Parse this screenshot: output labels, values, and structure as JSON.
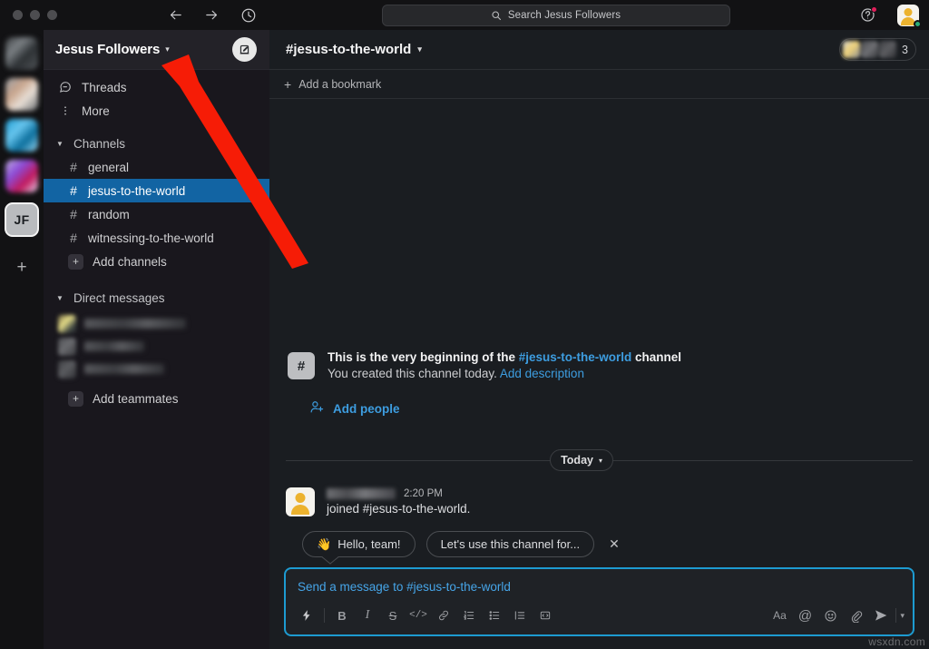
{
  "browser": {
    "back_icon": "arrow-left-icon",
    "forward_icon": "arrow-right-icon",
    "history_icon": "clock-icon",
    "search_placeholder": "Search Jesus Followers",
    "help_icon": "question-mark-icon",
    "user_avatar": "user-avatar"
  },
  "rail": {
    "workspaces": [
      {
        "name": "workspace-1",
        "colors": [
          "#3d4043",
          "#7b8084",
          "#2d3134",
          "#515559"
        ]
      },
      {
        "name": "workspace-2",
        "colors": [
          "#9aa0a6",
          "#c8a48c",
          "#e8dfd6",
          "#6b6f73"
        ]
      },
      {
        "name": "workspace-3",
        "colors": [
          "#1d9bd1",
          "#68c6ef",
          "#0b6e9c",
          "#9fdcf7"
        ]
      },
      {
        "name": "workspace-4",
        "colors": [
          "#c3b0e0",
          "#8b4dd8",
          "#c2185b",
          "#e6dcf5"
        ]
      }
    ],
    "active_workspace_initials": "JF",
    "add_workspace_label": "+"
  },
  "sidebar": {
    "workspace_name": "Jesus Followers",
    "compose_icon": "compose-pencil-icon",
    "nav": [
      {
        "label": "Threads",
        "icon": "threads-icon"
      },
      {
        "label": "More",
        "icon": "more-vertical-icon"
      }
    ],
    "channels_section": {
      "title": "Channels",
      "items": [
        {
          "label": "general",
          "selected": false
        },
        {
          "label": "jesus-to-the-world",
          "selected": true
        },
        {
          "label": "random",
          "selected": false
        },
        {
          "label": "witnessing-to-the-world",
          "selected": false
        }
      ],
      "add_label": "Add channels"
    },
    "dm_section": {
      "title": "Direct messages",
      "redacted_count": 3,
      "add_label": "Add teammates"
    }
  },
  "channel": {
    "name": "#jesus-to-the-world",
    "member_count": "3",
    "bookmark_label": "Add a bookmark"
  },
  "intro": {
    "hash": "#",
    "line1_before": "This is the very beginning of the ",
    "line1_link": "#jesus-to-the-world",
    "line1_after": " channel",
    "line2_text": "You created this channel today. ",
    "line2_link": "Add description",
    "add_people_label": "Add people",
    "add_people_icon": "person-plus-icon"
  },
  "messages": {
    "day_divider": "Today",
    "items": [
      {
        "author": "redacted-user",
        "time": "2:20 PM",
        "text": "joined #jesus-to-the-world."
      }
    ]
  },
  "suggestions": {
    "chip1_emoji": "👋",
    "chip1_label": "Hello, team!",
    "chip2_label": "Let's use this channel for...",
    "dismiss_icon": "close-icon"
  },
  "composer": {
    "placeholder": "Send a message to #jesus-to-the-world",
    "left_tools": [
      {
        "name": "shortcuts-lightning-icon",
        "glyph": "⚡"
      },
      {
        "name": "bold-icon",
        "glyph": "B"
      },
      {
        "name": "italic-icon",
        "glyph": "I"
      },
      {
        "name": "strikethrough-icon",
        "glyph": "S"
      },
      {
        "name": "code-icon",
        "glyph": "</>"
      },
      {
        "name": "link-icon",
        "glyph": "🔗"
      },
      {
        "name": "ordered-list-icon",
        "glyph": "1."
      },
      {
        "name": "bulleted-list-icon",
        "glyph": "•"
      },
      {
        "name": "blockquote-icon",
        "glyph": "❝"
      },
      {
        "name": "code-block-icon",
        "glyph": "▣"
      }
    ],
    "right_tools": [
      {
        "name": "formatting-aa-icon",
        "glyph": "Aa"
      },
      {
        "name": "mention-icon",
        "glyph": "@"
      },
      {
        "name": "emoji-icon",
        "glyph": "☺"
      },
      {
        "name": "attachment-icon",
        "glyph": "📎"
      },
      {
        "name": "send-icon",
        "glyph": "➤"
      },
      {
        "name": "send-options-chevron-icon",
        "glyph": "⌄"
      }
    ]
  },
  "annotation": {
    "arrow_color": "#f61c06",
    "points_to": "workspace-name-dropdown"
  },
  "watermark": "wsxdn.com",
  "colors": {
    "accent_blue": "#1264a3",
    "link_blue": "#3d9de0",
    "sidebar_bg": "#19171d",
    "main_bg": "#1a1d21",
    "chrome_bg": "#121214",
    "focus_blue": "#1d9bd1",
    "presence_green": "#2bac76",
    "badge_red": "#e01e5a",
    "avatar_gold": "#ecb22e"
  }
}
